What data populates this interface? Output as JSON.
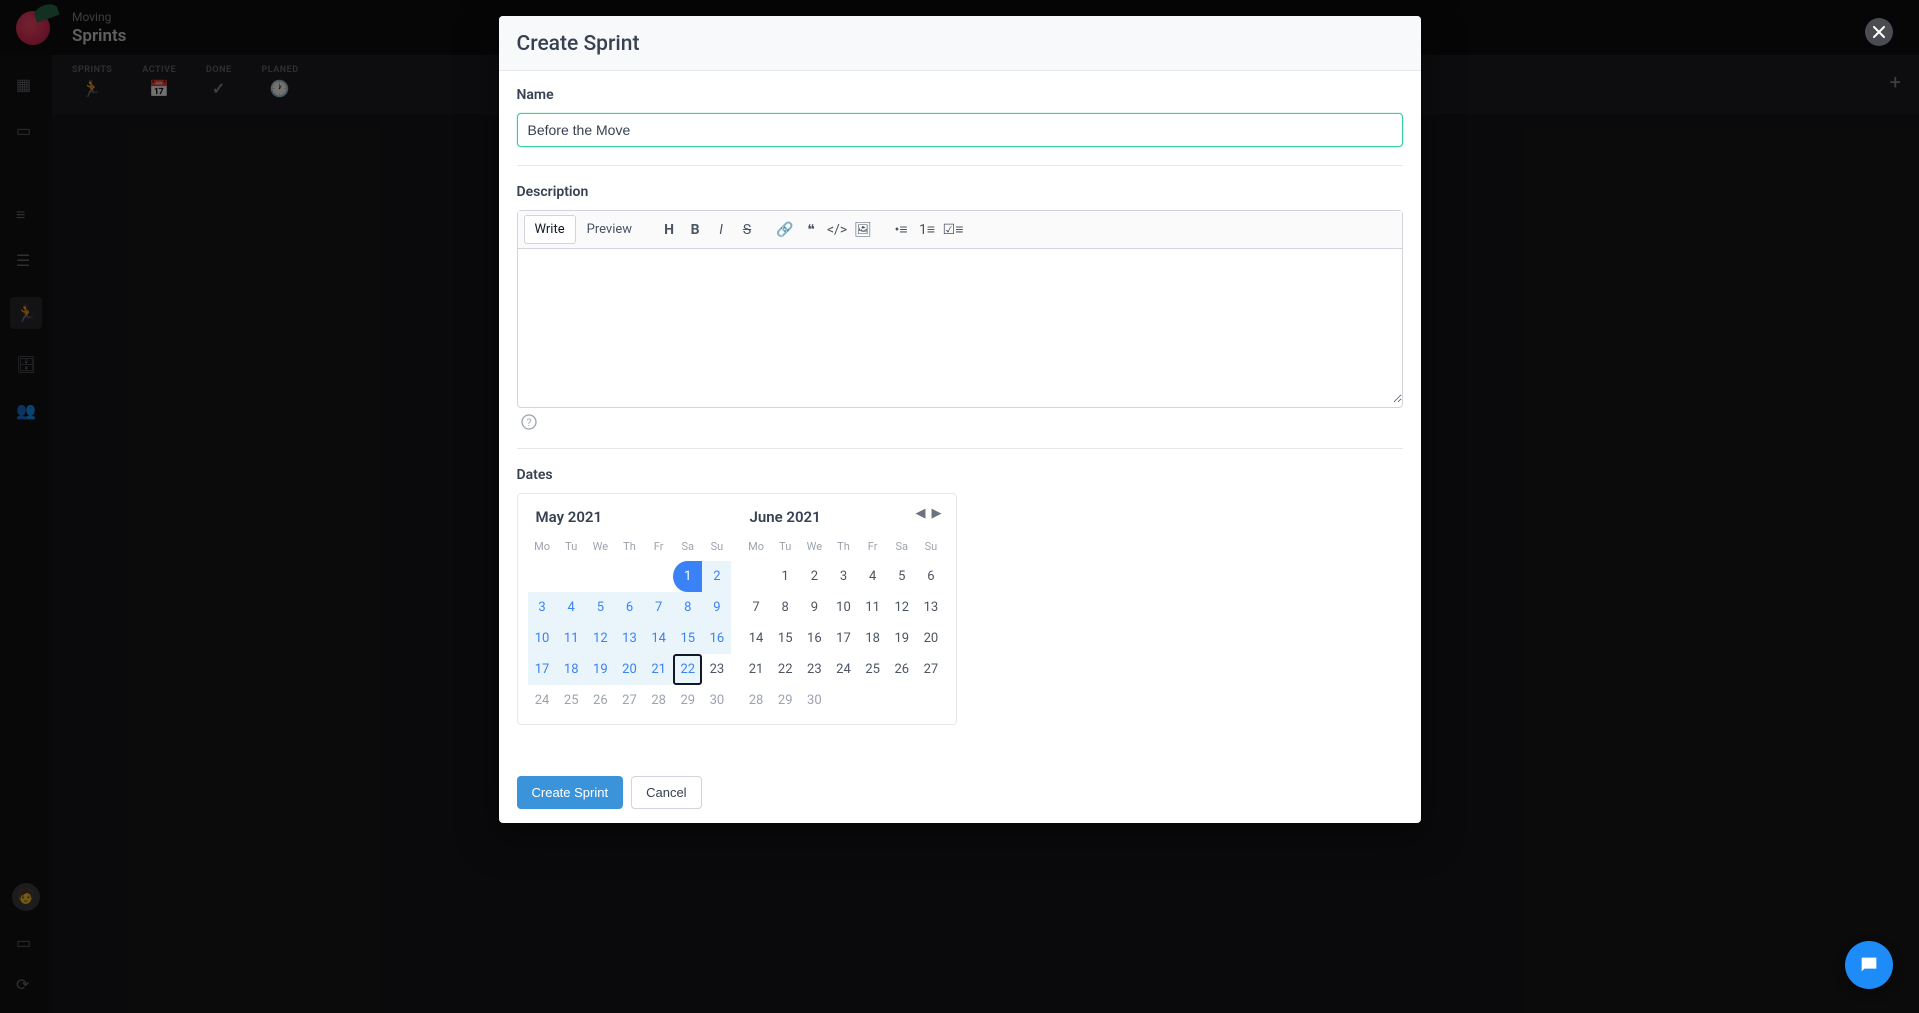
{
  "app": {
    "breadcrumb": "Moving",
    "title": "Sprints",
    "tabs": [
      {
        "label": "SPRINTS"
      },
      {
        "label": "ACTIVE"
      },
      {
        "label": "DONE"
      },
      {
        "label": "PLANED"
      }
    ]
  },
  "modal": {
    "title": "Create Sprint",
    "name_label": "Name",
    "name_value": "Before the Move",
    "description_label": "Description",
    "editor_tabs": {
      "write": "Write",
      "preview": "Preview"
    },
    "dates_label": "Dates",
    "footer": {
      "submit": "Create Sprint",
      "cancel": "Cancel"
    }
  },
  "calendar": {
    "dow": [
      "Mo",
      "Tu",
      "We",
      "Th",
      "Fr",
      "Sa",
      "Su"
    ],
    "left": {
      "title": "May 2021",
      "weeks": [
        [
          null,
          null,
          null,
          null,
          null,
          {
            "d": 1,
            "start": true
          },
          {
            "d": 2,
            "range": true
          }
        ],
        [
          {
            "d": 3,
            "range": true
          },
          {
            "d": 4,
            "range": true
          },
          {
            "d": 5,
            "range": true
          },
          {
            "d": 6,
            "range": true
          },
          {
            "d": 7,
            "range": true
          },
          {
            "d": 8,
            "range": true
          },
          {
            "d": 9,
            "range": true
          }
        ],
        [
          {
            "d": 10,
            "range": true
          },
          {
            "d": 11,
            "range": true
          },
          {
            "d": 12,
            "range": true
          },
          {
            "d": 13,
            "range": true
          },
          {
            "d": 14,
            "range": true
          },
          {
            "d": 15,
            "range": true
          },
          {
            "d": 16,
            "range": true
          }
        ],
        [
          {
            "d": 17,
            "range": true
          },
          {
            "d": 18,
            "range": true
          },
          {
            "d": 19,
            "range": true
          },
          {
            "d": 20,
            "range": true
          },
          {
            "d": 21,
            "range": true
          },
          {
            "d": 22,
            "today": true,
            "range": true
          },
          {
            "d": 23
          }
        ],
        [
          {
            "d": 24,
            "faded": true
          },
          {
            "d": 25,
            "faded": true
          },
          {
            "d": 26,
            "faded": true
          },
          {
            "d": 27,
            "faded": true
          },
          {
            "d": 28,
            "faded": true
          },
          {
            "d": 29,
            "faded": true
          },
          {
            "d": 30,
            "faded": true
          }
        ]
      ]
    },
    "right": {
      "title": "June 2021",
      "weeks": [
        [
          null,
          {
            "d": 1
          },
          {
            "d": 2
          },
          {
            "d": 3
          },
          {
            "d": 4
          },
          {
            "d": 5
          },
          {
            "d": 6
          }
        ],
        [
          {
            "d": 7
          },
          {
            "d": 8
          },
          {
            "d": 9
          },
          {
            "d": 10
          },
          {
            "d": 11
          },
          {
            "d": 12
          },
          {
            "d": 13
          }
        ],
        [
          {
            "d": 14
          },
          {
            "d": 15
          },
          {
            "d": 16
          },
          {
            "d": 17
          },
          {
            "d": 18
          },
          {
            "d": 19
          },
          {
            "d": 20
          }
        ],
        [
          {
            "d": 21
          },
          {
            "d": 22
          },
          {
            "d": 23
          },
          {
            "d": 24
          },
          {
            "d": 25
          },
          {
            "d": 26
          },
          {
            "d": 27
          }
        ],
        [
          {
            "d": 28,
            "faded": true
          },
          {
            "d": 29,
            "faded": true
          },
          {
            "d": 30,
            "faded": true
          },
          null,
          null,
          null,
          null
        ]
      ]
    }
  }
}
